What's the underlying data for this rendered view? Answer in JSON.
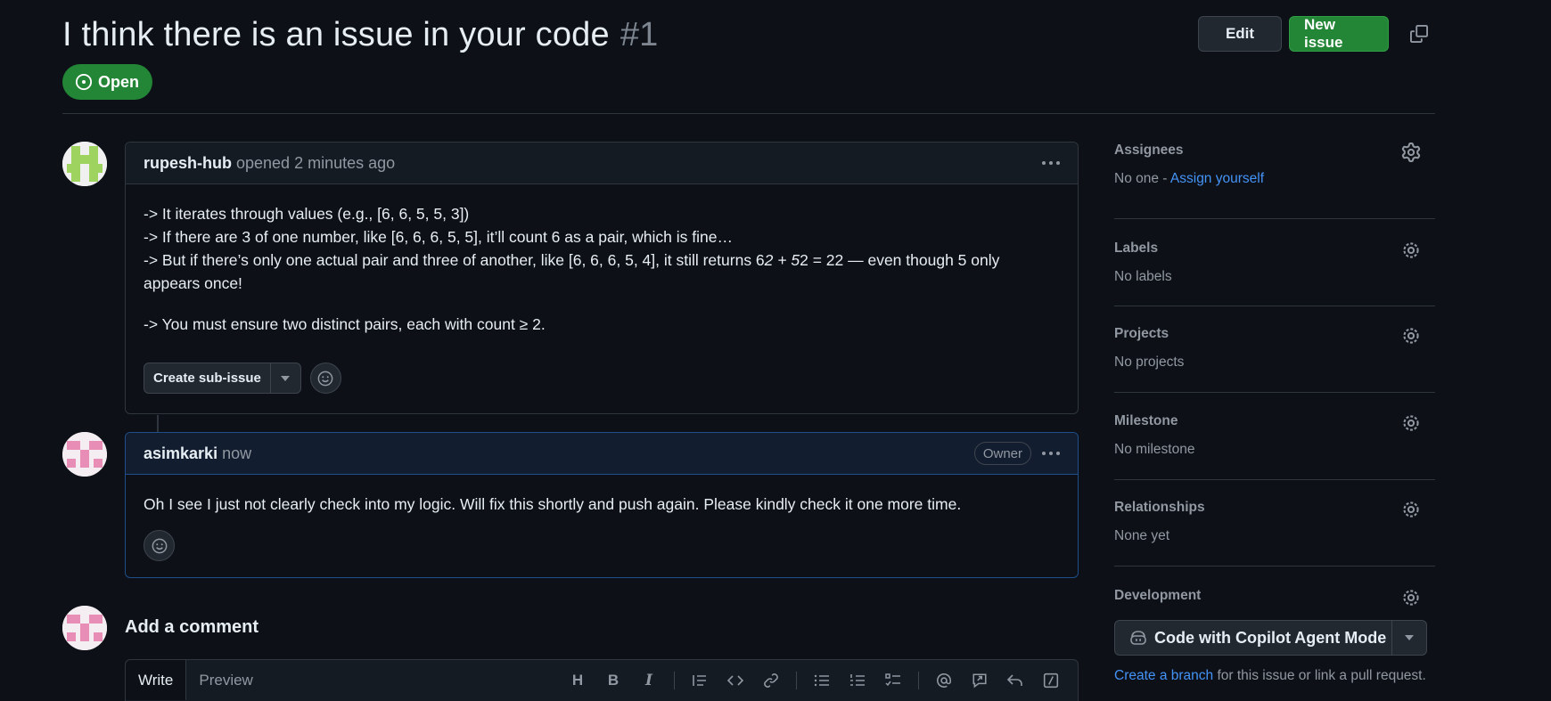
{
  "issue": {
    "title": "I think there is an issue in your code",
    "number": "#1",
    "state": "Open",
    "edit_label": "Edit",
    "new_issue_label": "New issue"
  },
  "comments": [
    {
      "author": "rupesh-hub",
      "meta": "opened 2 minutes ago",
      "lines": [
        "-> It iterates through values (e.g., [6, 6, 5, 5, 3])",
        "-> If there are 3 of one number, like [6, 6, 6, 5, 5], it’ll count 6 as a pair, which is fine…",
        "-> But if there’s only one actual pair and three of another, like [6, 6, 6, 5, 4], it still returns 6",
        "2 + 5",
        "2 = 22 — even though 5 only appears once!",
        "-> You must ensure two distinct pairs, each with count ≥ 2."
      ],
      "create_subissue_label": "Create sub-issue"
    },
    {
      "author": "asimkarki",
      "meta": "now",
      "badge": "Owner",
      "text": "Oh I see I just not clearly check into my logic. Will fix this shortly and push again. Please kindly check it one more time."
    }
  ],
  "add_comment": {
    "title": "Add a comment",
    "tabs": [
      "Write",
      "Preview"
    ],
    "toolbar_icons": [
      "heading-icon",
      "bold-icon",
      "italic-icon",
      "quote-icon",
      "code-icon",
      "link-icon",
      "bulleted-list-icon",
      "numbered-list-icon",
      "task-list-icon",
      "mention-icon",
      "reference-icon",
      "reply-icon",
      "slash-commands-icon"
    ]
  },
  "sidebar": {
    "assignees": {
      "title": "Assignees",
      "value": "No one - ",
      "link": "Assign yourself"
    },
    "labels": {
      "title": "Labels",
      "value": "No labels"
    },
    "projects": {
      "title": "Projects",
      "value": "No projects"
    },
    "milestone": {
      "title": "Milestone",
      "value": "No milestone"
    },
    "relationships": {
      "title": "Relationships",
      "value": "None yet"
    },
    "development": {
      "title": "Development",
      "copilot_label": "Code with Copilot Agent Mode",
      "link": "Create a branch",
      "note": " for this issue or link a pull request."
    }
  },
  "colors": {
    "green": "#238636",
    "link": "#4493f8",
    "bg": "#0d1117"
  }
}
